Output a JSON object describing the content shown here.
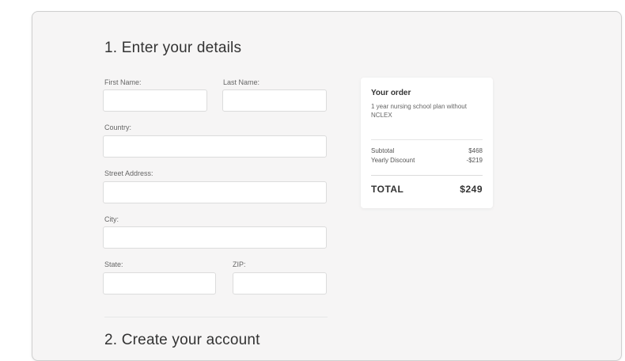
{
  "details": {
    "title": "1. Enter your details",
    "first_name_label": "First Name:",
    "last_name_label": "Last Name:",
    "country_label": "Country:",
    "street_label": "Street Address:",
    "city_label": "City:",
    "state_label": "State:",
    "zip_label": "ZIP:",
    "first_name_value": "",
    "last_name_value": "",
    "country_value": "",
    "street_value": "",
    "city_value": "",
    "state_value": "",
    "zip_value": ""
  },
  "account": {
    "title": "2. Create your account"
  },
  "order": {
    "title": "Your order",
    "description": "1 year nursing school plan without NCLEX",
    "subtotal_label": "Subtotal",
    "subtotal_value": "$468",
    "discount_label": "Yearly Discount",
    "discount_value": "-$219",
    "total_label": "TOTAL",
    "total_value": "$249"
  }
}
